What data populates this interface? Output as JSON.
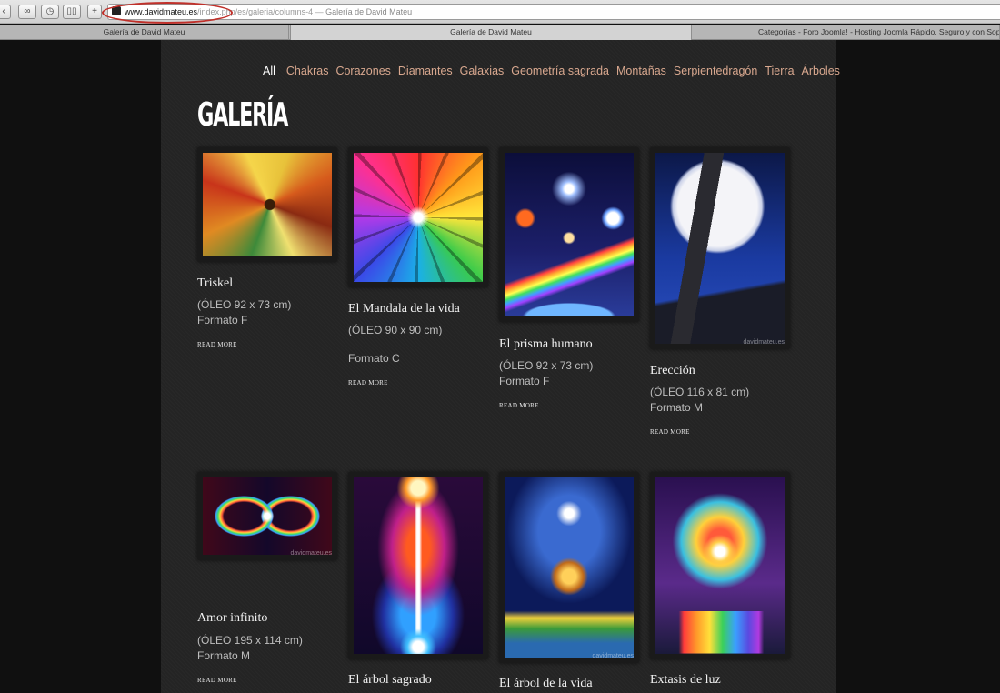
{
  "browser": {
    "host": "www.davidmateu.es",
    "path": "/index.php/es/galeria/columns-4",
    "separator": " — ",
    "page_title": "Galería de David Mateu",
    "tabs": [
      "Galería de David Mateu",
      "Galería de David Mateu",
      "Categorías - Foro Joomla! - Hosting Joomla Rápido, Seguro y con Soporte"
    ]
  },
  "nav": {
    "items": [
      "All",
      "Chakras",
      "Corazones",
      "Diamantes",
      "Galaxias",
      "Geometría sagrada",
      "Montañas",
      "Serpientedragón",
      "Tierra",
      "Árboles"
    ]
  },
  "page": {
    "heading": "GALERÍA",
    "watermark": "davidmateu.es"
  },
  "gallery": [
    {
      "title": "Triskel",
      "size": "(ÓLEO 92 x 73 cm)",
      "format": "Formato F",
      "more": "READ MORE"
    },
    {
      "title": "El Mandala de la vida",
      "size": "(ÓLEO 90 x 90 cm)",
      "format": "Formato C",
      "more": "READ MORE"
    },
    {
      "title": "El prisma humano",
      "size": "(ÓLEO 92 x 73 cm)",
      "format": "Formato F",
      "more": "READ MORE"
    },
    {
      "title": "Erección",
      "size": "(ÓLEO 116 x 81 cm)",
      "format": "Formato M",
      "more": "READ MORE"
    },
    {
      "title": "Amor infinito",
      "size": "(ÓLEO 195 x 114 cm)",
      "format": "Formato M",
      "more": "READ MORE"
    },
    {
      "title": "El árbol sagrado"
    },
    {
      "title": "El árbol de la vida"
    },
    {
      "title": "Extasis de luz"
    }
  ]
}
